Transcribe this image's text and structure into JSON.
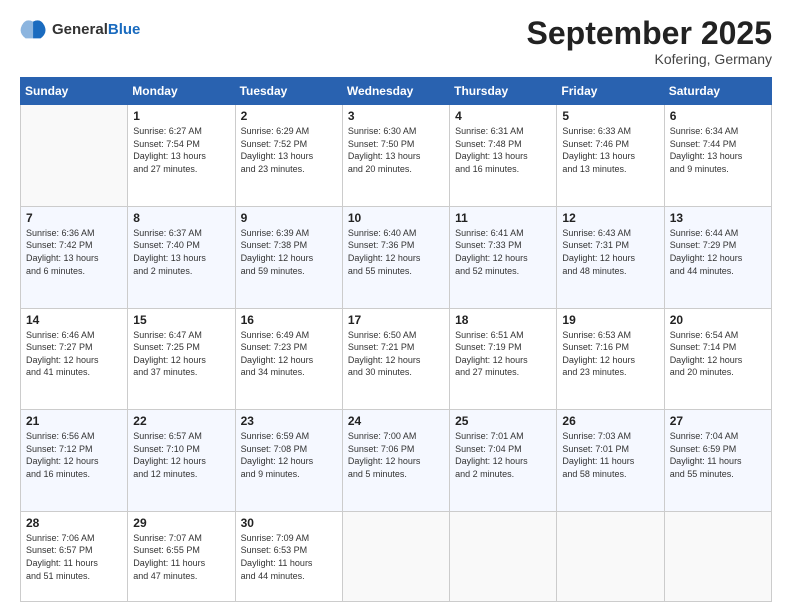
{
  "logo": {
    "general": "General",
    "blue": "Blue"
  },
  "header": {
    "month": "September 2025",
    "location": "Kofering, Germany"
  },
  "weekdays": [
    "Sunday",
    "Monday",
    "Tuesday",
    "Wednesday",
    "Thursday",
    "Friday",
    "Saturday"
  ],
  "weeks": [
    [
      {
        "day": "",
        "info": ""
      },
      {
        "day": "1",
        "info": "Sunrise: 6:27 AM\nSunset: 7:54 PM\nDaylight: 13 hours\nand 27 minutes."
      },
      {
        "day": "2",
        "info": "Sunrise: 6:29 AM\nSunset: 7:52 PM\nDaylight: 13 hours\nand 23 minutes."
      },
      {
        "day": "3",
        "info": "Sunrise: 6:30 AM\nSunset: 7:50 PM\nDaylight: 13 hours\nand 20 minutes."
      },
      {
        "day": "4",
        "info": "Sunrise: 6:31 AM\nSunset: 7:48 PM\nDaylight: 13 hours\nand 16 minutes."
      },
      {
        "day": "5",
        "info": "Sunrise: 6:33 AM\nSunset: 7:46 PM\nDaylight: 13 hours\nand 13 minutes."
      },
      {
        "day": "6",
        "info": "Sunrise: 6:34 AM\nSunset: 7:44 PM\nDaylight: 13 hours\nand 9 minutes."
      }
    ],
    [
      {
        "day": "7",
        "info": "Sunrise: 6:36 AM\nSunset: 7:42 PM\nDaylight: 13 hours\nand 6 minutes."
      },
      {
        "day": "8",
        "info": "Sunrise: 6:37 AM\nSunset: 7:40 PM\nDaylight: 13 hours\nand 2 minutes."
      },
      {
        "day": "9",
        "info": "Sunrise: 6:39 AM\nSunset: 7:38 PM\nDaylight: 12 hours\nand 59 minutes."
      },
      {
        "day": "10",
        "info": "Sunrise: 6:40 AM\nSunset: 7:36 PM\nDaylight: 12 hours\nand 55 minutes."
      },
      {
        "day": "11",
        "info": "Sunrise: 6:41 AM\nSunset: 7:33 PM\nDaylight: 12 hours\nand 52 minutes."
      },
      {
        "day": "12",
        "info": "Sunrise: 6:43 AM\nSunset: 7:31 PM\nDaylight: 12 hours\nand 48 minutes."
      },
      {
        "day": "13",
        "info": "Sunrise: 6:44 AM\nSunset: 7:29 PM\nDaylight: 12 hours\nand 44 minutes."
      }
    ],
    [
      {
        "day": "14",
        "info": "Sunrise: 6:46 AM\nSunset: 7:27 PM\nDaylight: 12 hours\nand 41 minutes."
      },
      {
        "day": "15",
        "info": "Sunrise: 6:47 AM\nSunset: 7:25 PM\nDaylight: 12 hours\nand 37 minutes."
      },
      {
        "day": "16",
        "info": "Sunrise: 6:49 AM\nSunset: 7:23 PM\nDaylight: 12 hours\nand 34 minutes."
      },
      {
        "day": "17",
        "info": "Sunrise: 6:50 AM\nSunset: 7:21 PM\nDaylight: 12 hours\nand 30 minutes."
      },
      {
        "day": "18",
        "info": "Sunrise: 6:51 AM\nSunset: 7:19 PM\nDaylight: 12 hours\nand 27 minutes."
      },
      {
        "day": "19",
        "info": "Sunrise: 6:53 AM\nSunset: 7:16 PM\nDaylight: 12 hours\nand 23 minutes."
      },
      {
        "day": "20",
        "info": "Sunrise: 6:54 AM\nSunset: 7:14 PM\nDaylight: 12 hours\nand 20 minutes."
      }
    ],
    [
      {
        "day": "21",
        "info": "Sunrise: 6:56 AM\nSunset: 7:12 PM\nDaylight: 12 hours\nand 16 minutes."
      },
      {
        "day": "22",
        "info": "Sunrise: 6:57 AM\nSunset: 7:10 PM\nDaylight: 12 hours\nand 12 minutes."
      },
      {
        "day": "23",
        "info": "Sunrise: 6:59 AM\nSunset: 7:08 PM\nDaylight: 12 hours\nand 9 minutes."
      },
      {
        "day": "24",
        "info": "Sunrise: 7:00 AM\nSunset: 7:06 PM\nDaylight: 12 hours\nand 5 minutes."
      },
      {
        "day": "25",
        "info": "Sunrise: 7:01 AM\nSunset: 7:04 PM\nDaylight: 12 hours\nand 2 minutes."
      },
      {
        "day": "26",
        "info": "Sunrise: 7:03 AM\nSunset: 7:01 PM\nDaylight: 11 hours\nand 58 minutes."
      },
      {
        "day": "27",
        "info": "Sunrise: 7:04 AM\nSunset: 6:59 PM\nDaylight: 11 hours\nand 55 minutes."
      }
    ],
    [
      {
        "day": "28",
        "info": "Sunrise: 7:06 AM\nSunset: 6:57 PM\nDaylight: 11 hours\nand 51 minutes."
      },
      {
        "day": "29",
        "info": "Sunrise: 7:07 AM\nSunset: 6:55 PM\nDaylight: 11 hours\nand 47 minutes."
      },
      {
        "day": "30",
        "info": "Sunrise: 7:09 AM\nSunset: 6:53 PM\nDaylight: 11 hours\nand 44 minutes."
      },
      {
        "day": "",
        "info": ""
      },
      {
        "day": "",
        "info": ""
      },
      {
        "day": "",
        "info": ""
      },
      {
        "day": "",
        "info": ""
      }
    ]
  ]
}
